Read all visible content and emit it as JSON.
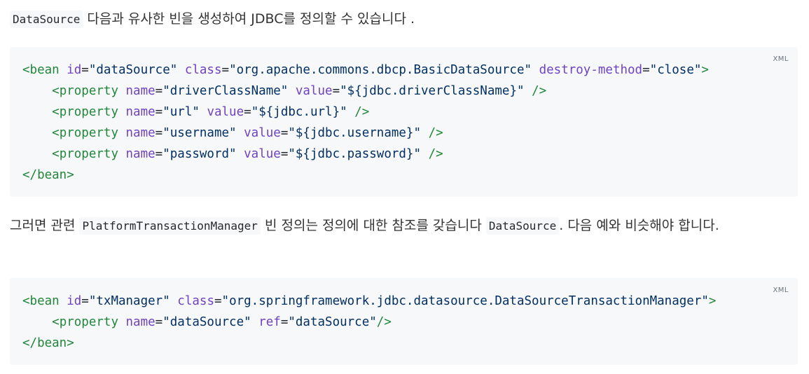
{
  "intro": {
    "code_term": "DataSource",
    "text": " 다음과 유사한 빈을 생성하여 JDBC를 정의할 수 있습니다 ."
  },
  "code_block_1": {
    "language": "XML",
    "lines": [
      [
        [
          "t",
          "<bean "
        ],
        [
          "a",
          "id"
        ],
        [
          "p",
          "="
        ],
        [
          "s",
          "\"dataSource\""
        ],
        [
          "p",
          " "
        ],
        [
          "a",
          "class"
        ],
        [
          "p",
          "="
        ],
        [
          "s",
          "\"org.apache.commons.dbcp.BasicDataSource\""
        ],
        [
          "p",
          " "
        ],
        [
          "a",
          "destroy-method"
        ],
        [
          "p",
          "="
        ],
        [
          "s",
          "\"close\""
        ],
        [
          "t",
          ">"
        ]
      ],
      [
        [
          "p",
          "    "
        ],
        [
          "t",
          "<property "
        ],
        [
          "a",
          "name"
        ],
        [
          "p",
          "="
        ],
        [
          "s",
          "\"driverClassName\""
        ],
        [
          "p",
          " "
        ],
        [
          "a",
          "value"
        ],
        [
          "p",
          "="
        ],
        [
          "s",
          "\"${jdbc.driverClassName}\""
        ],
        [
          "p",
          " "
        ],
        [
          "t",
          "/>"
        ]
      ],
      [
        [
          "p",
          "    "
        ],
        [
          "t",
          "<property "
        ],
        [
          "a",
          "name"
        ],
        [
          "p",
          "="
        ],
        [
          "s",
          "\"url\""
        ],
        [
          "p",
          " "
        ],
        [
          "a",
          "value"
        ],
        [
          "p",
          "="
        ],
        [
          "s",
          "\"${jdbc.url}\""
        ],
        [
          "p",
          " "
        ],
        [
          "t",
          "/>"
        ]
      ],
      [
        [
          "p",
          "    "
        ],
        [
          "t",
          "<property "
        ],
        [
          "a",
          "name"
        ],
        [
          "p",
          "="
        ],
        [
          "s",
          "\"username\""
        ],
        [
          "p",
          " "
        ],
        [
          "a",
          "value"
        ],
        [
          "p",
          "="
        ],
        [
          "s",
          "\"${jdbc.username}\""
        ],
        [
          "p",
          " "
        ],
        [
          "t",
          "/>"
        ]
      ],
      [
        [
          "p",
          "    "
        ],
        [
          "t",
          "<property "
        ],
        [
          "a",
          "name"
        ],
        [
          "p",
          "="
        ],
        [
          "s",
          "\"password\""
        ],
        [
          "p",
          " "
        ],
        [
          "a",
          "value"
        ],
        [
          "p",
          "="
        ],
        [
          "s",
          "\"${jdbc.password}\""
        ],
        [
          "p",
          " "
        ],
        [
          "t",
          "/>"
        ]
      ],
      [
        [
          "t",
          "</bean>"
        ]
      ]
    ]
  },
  "middle": {
    "text_1": "그러면 관련 ",
    "code_term_1": "PlatformTransactionManager",
    "text_2": " 빈 정의는 정의에 대한 참조를 갖습니다 ",
    "code_term_2": "DataSource",
    "text_3": ". 다음 예와 비슷해야 합니다."
  },
  "code_block_2": {
    "language": "XML",
    "lines": [
      [
        [
          "t",
          "<bean "
        ],
        [
          "a",
          "id"
        ],
        [
          "p",
          "="
        ],
        [
          "s",
          "\"txManager\""
        ],
        [
          "p",
          " "
        ],
        [
          "a",
          "class"
        ],
        [
          "p",
          "="
        ],
        [
          "s",
          "\"org.springframework.jdbc.datasource.DataSourceTransactionManager\""
        ],
        [
          "t",
          ">"
        ]
      ],
      [
        [
          "p",
          "    "
        ],
        [
          "t",
          "<property "
        ],
        [
          "a",
          "name"
        ],
        [
          "p",
          "="
        ],
        [
          "s",
          "\"dataSource\""
        ],
        [
          "p",
          " "
        ],
        [
          "a",
          "ref"
        ],
        [
          "p",
          "="
        ],
        [
          "s",
          "\"dataSource\""
        ],
        [
          "t",
          "/>"
        ]
      ],
      [
        [
          "t",
          "</bean>"
        ]
      ]
    ]
  }
}
